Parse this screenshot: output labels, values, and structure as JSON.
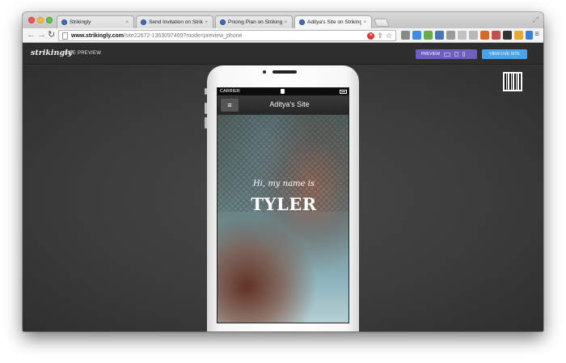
{
  "browser": {
    "tabs": [
      {
        "label": "Strikingly",
        "active": false
      },
      {
        "label": "Send Invitation on Striking",
        "active": false
      },
      {
        "label": "Pricing Plan on Strikingly",
        "active": false
      },
      {
        "label": "Aditya's Site on Strikingly",
        "active": true
      }
    ],
    "url_host": "www.strikingly.com",
    "url_path": "/site22672-1363097469?mode=preview_phone",
    "close_glyph": "×",
    "star_glyph": "☆"
  },
  "app": {
    "logo": "strikingly",
    "section_label": "SITE PREVIEW",
    "preview_label": "PREVIEW",
    "view_live_label": "VIEW LIVE SITE"
  },
  "phone": {
    "carrier": "CARRIER",
    "site_title": "Aditya's Site",
    "menu_glyph": "≡",
    "greeting": "Hi, my name is",
    "name": "TYLER"
  },
  "colors": {
    "preview_button": "#6c5fc0",
    "live_button": "#4aa3e8",
    "app_bar": "#2e2e2e"
  },
  "icons": [
    "back-icon",
    "forward-icon",
    "reload-icon",
    "page-icon",
    "stop-icon",
    "star-icon",
    "hamburger-menu-icon",
    "qr-code-icon",
    "lock-icon",
    "battery-icon"
  ]
}
